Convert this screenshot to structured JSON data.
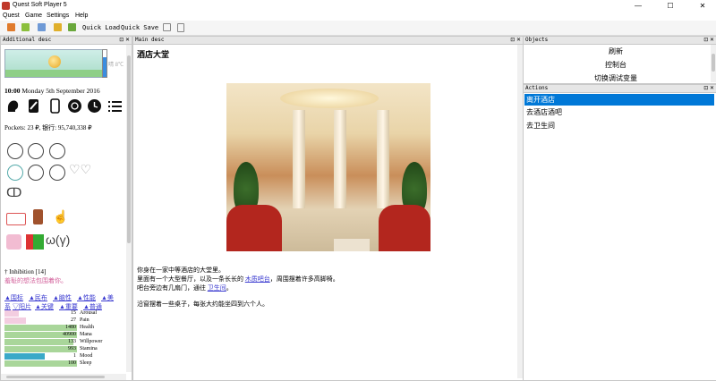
{
  "window": {
    "title": "Quest Soft Player 5",
    "minimize": "—",
    "maximize": "☐",
    "close": "✕"
  },
  "menu": [
    "Quest",
    "Game",
    "Settings",
    "Help"
  ],
  "toolbar": {
    "quick_load": "Quick Load",
    "quick_save": "Quick Save"
  },
  "panels": {
    "additional": "Additional desc",
    "main": "Main desc",
    "objects": "Objects",
    "actions": "Actions",
    "controls": "⊡ ✕"
  },
  "left": {
    "banner_aside": "晴 8℃",
    "datetime_time": "10:00",
    "datetime_rest": " Monday 5th September 2016",
    "pockets": "Pockets: 23 ₽, 银行: 95,740,338 ₽",
    "inhibition": "† Inhibition [14]",
    "inhibition_hint": "羞耻的想法包围着你。",
    "tags_row1": [
      "▲围标",
      "▲民布",
      "▲脑性",
      "▲性能",
      "▲美"
    ],
    "tags_row2": [
      "系",
      "▽阳片",
      "▲关键",
      "▲重要",
      "▲普通"
    ],
    "bars": [
      {
        "name": "Arousal",
        "value": "15",
        "fraction": 0.2,
        "color": "#f3cde0"
      },
      {
        "name": "Pain",
        "value": "27",
        "fraction": 0.3,
        "color": "#f3cde0"
      },
      {
        "name": "Health",
        "value": "1480",
        "fraction": 1.0,
        "color": "#a9d69a"
      },
      {
        "name": "Mana",
        "value": "40900",
        "fraction": 1.0,
        "color": "#a9d69a"
      },
      {
        "name": "Willpower",
        "value": "133",
        "fraction": 0.95,
        "color": "#a9d69a"
      },
      {
        "name": "Stamina",
        "value": "993",
        "fraction": 1.0,
        "color": "#a9d69a"
      },
      {
        "name": "Mood",
        "value": "1",
        "fraction": 0.55,
        "color": "#3aa9c8"
      },
      {
        "name": "Sleep",
        "value": "100",
        "fraction": 1.0,
        "color": "#a9d69a"
      }
    ]
  },
  "main": {
    "room_title": "酒店大堂",
    "line1": "你身在一家中等酒店的大堂里。",
    "line2_before": "里面有一个大型餐厅，以及一条长长的 ",
    "line2_link": "木质吧台",
    "line2_after": "，周围摆着许多高脚椅。",
    "line3_before": "吧台旁边有几扇门，通往 ",
    "line3_link": "卫生间",
    "line3_after": "。",
    "line4": "沿窗摆着一些桌子，每张大约能坐四到六个人。"
  },
  "objects": [
    "刷新",
    "控制台",
    "切换调试变量"
  ],
  "actions": [
    "离开酒店",
    "去酒店酒吧",
    "去卫生间"
  ]
}
